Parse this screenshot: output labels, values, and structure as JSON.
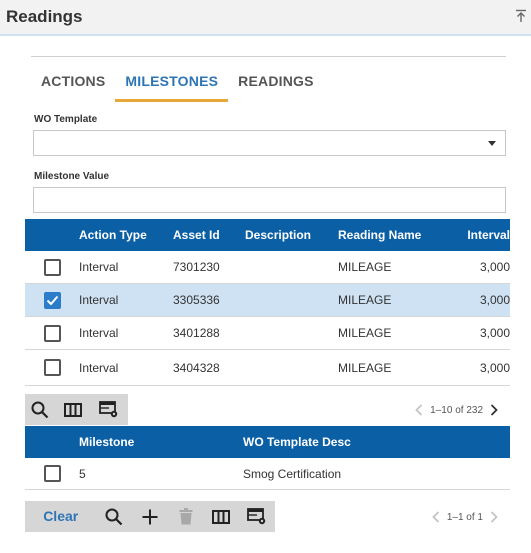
{
  "header": {
    "title": "Readings"
  },
  "tabs": [
    {
      "label": "ACTIONS",
      "active": false
    },
    {
      "label": "MILESTONES",
      "active": true
    },
    {
      "label": "READINGS",
      "active": false
    }
  ],
  "form": {
    "wo_template_label": "WO Template",
    "wo_template_value": "",
    "milestone_value_label": "Milestone Value",
    "milestone_value": ""
  },
  "readings_grid": {
    "columns": [
      "Action Type",
      "Asset Id",
      "Description",
      "Reading Name",
      "Interval"
    ],
    "rows": [
      {
        "action_type": "Interval",
        "asset_id": "7301230",
        "description": "",
        "reading_name": "MILEAGE",
        "interval": "3,000",
        "checked": false
      },
      {
        "action_type": "Interval",
        "asset_id": "3305336",
        "description": "",
        "reading_name": "MILEAGE",
        "interval": "3,000",
        "checked": true
      },
      {
        "action_type": "Interval",
        "asset_id": "3401288",
        "description": "",
        "reading_name": "MILEAGE",
        "interval": "3,000",
        "checked": false
      },
      {
        "action_type": "Interval",
        "asset_id": "3404328",
        "description": "",
        "reading_name": "MILEAGE",
        "interval": "3,000",
        "checked": false
      }
    ],
    "pager": "1–10 of 232"
  },
  "milestones_grid": {
    "columns": [
      "Milestone",
      "WO Template Desc"
    ],
    "rows": [
      {
        "milestone": "5",
        "wo_template_desc": "Smog Certification",
        "checked": false
      }
    ],
    "pager": "1–1 of 1"
  },
  "toolbar": {
    "clear_label": "Clear"
  },
  "icons": [
    "collapse-icon",
    "chevron-down-icon",
    "search-icon",
    "columns-icon",
    "grid-settings-icon",
    "add-icon",
    "delete-icon",
    "chevron-left-icon",
    "chevron-right-icon"
  ],
  "colors": {
    "accent": "#2e75b6",
    "grid_header": "#0b5fa5",
    "tab_underline": "#e8a73a",
    "selected_row": "#cfe2f3",
    "checkbox_checked": "#2b7cc9"
  }
}
